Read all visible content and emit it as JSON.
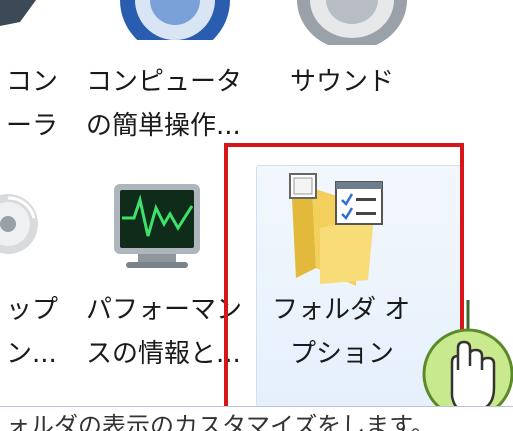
{
  "items": {
    "ease": {
      "line1": "コンピュータ",
      "line2": "の簡単操作..."
    },
    "sound": {
      "line1": "サウンド"
    },
    "left_top": {
      "line1": "コン",
      "line2": "ーラ"
    },
    "backup": {
      "line1": "ップ",
      "line2": "ン..."
    },
    "perf": {
      "line1": "パフォーマン",
      "line2": "スの情報と..."
    },
    "folder": {
      "line1": "フォルダ オ",
      "line2": "プション"
    }
  },
  "status": {
    "text": "ォルダの表示のカスタマイズをします。"
  },
  "colors": {
    "highlight": "#d7161a",
    "hover_bg": "#e6f0fb",
    "cursor_bg": "#c9e98e"
  },
  "icons": [
    "ease-of-access-icon",
    "sound-icon",
    "backup-disc-icon",
    "performance-monitor-icon",
    "folder-options-icon",
    "mouse-click-cursor-icon"
  ]
}
